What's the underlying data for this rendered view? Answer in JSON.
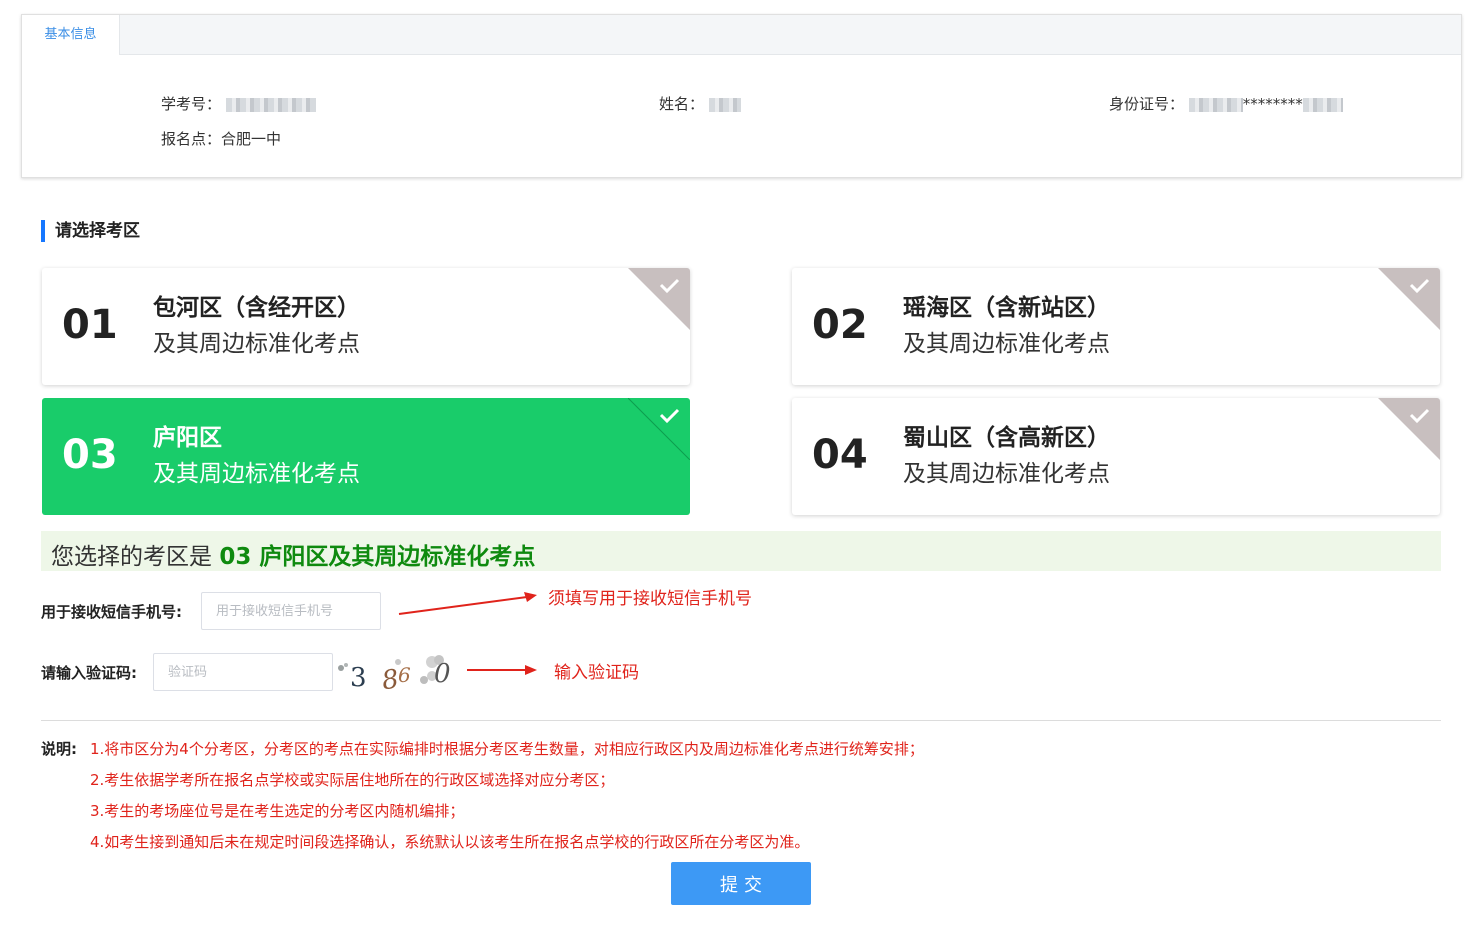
{
  "info": {
    "tab_label": "基本信息",
    "exam_no_label": "学考号：",
    "name_label": "姓名：",
    "id_label": "身份证号：",
    "id_visible_part": "********",
    "site_label": "报名点：",
    "site_value": "合肥一中"
  },
  "section_title": "请选择考区",
  "districts": [
    {
      "num": "01",
      "line1": "包河区（含经开区）",
      "line2": "及其周边标准化考点",
      "selected": false
    },
    {
      "num": "02",
      "line1": "瑶海区（含新站区）",
      "line2": "及其周边标准化考点",
      "selected": false
    },
    {
      "num": "03",
      "line1": "庐阳区",
      "line2": "及其周边标准化考点",
      "selected": true
    },
    {
      "num": "04",
      "line1": "蜀山区（含高新区）",
      "line2": "及其周边标准化考点",
      "selected": false
    }
  ],
  "result": {
    "prefix": "您选择的考区是 ",
    "choice": "03 庐阳区及其周边标准化考点"
  },
  "phone": {
    "label": "用于接收短信手机号:",
    "placeholder": "用于接收短信手机号",
    "value": "",
    "annotation": "须填写用于接收短信手机号"
  },
  "captcha": {
    "label": "请输入验证码:",
    "placeholder": "验证码",
    "value": "",
    "image_text": "3 86 0",
    "annotation": "输入验证码"
  },
  "notes": {
    "label": "说明:",
    "items": [
      "1.将市区分为4个分考区，分考区的考点在实际编排时根据分考区考生数量，对相应行政区内及周边标准化考点进行统筹安排；",
      "2.考生依据学考所在报名点学校或实际居住地所在的行政区域选择对应分考区；",
      "3.考生的考场座位号是在考生选定的分考区内随机编排；",
      "4.如考生接到通知后未在规定时间段选择确认，系统默认以该考生所在报名点学校的行政区所在分考区为准。"
    ]
  },
  "submit_label": "提交",
  "colors": {
    "selected_card": "#19cc6a",
    "unselected_corner": "#c8bfbf",
    "accent_blue": "#1677ff",
    "annotation_red": "#e0231b",
    "result_green": "#0f8a0f",
    "submit_blue": "#3d99f5"
  }
}
